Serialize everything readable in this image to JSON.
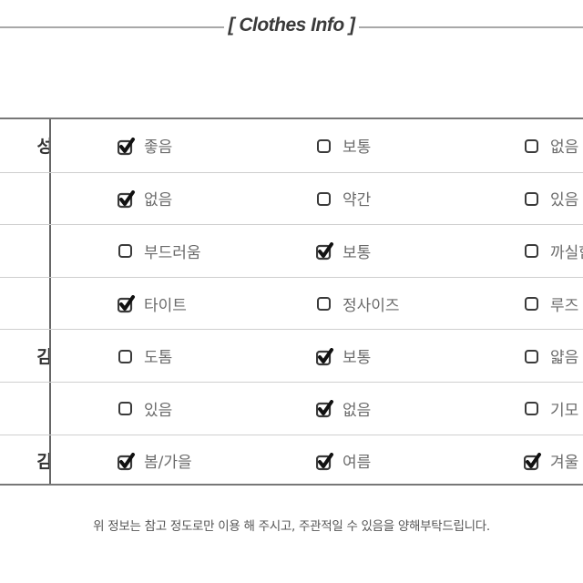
{
  "header": {
    "title": "[ Clothes Info ]"
  },
  "table": {
    "rows": [
      {
        "label": "성",
        "options": [
          {
            "label": "좋음",
            "checked": true
          },
          {
            "label": "보통",
            "checked": false
          },
          {
            "label": "없음",
            "checked": false
          }
        ]
      },
      {
        "label": "",
        "options": [
          {
            "label": "없음",
            "checked": true
          },
          {
            "label": "약간",
            "checked": false
          },
          {
            "label": "있음",
            "checked": false
          }
        ]
      },
      {
        "label": "",
        "options": [
          {
            "label": "부드러움",
            "checked": false
          },
          {
            "label": "보통",
            "checked": true
          },
          {
            "label": "까실함",
            "checked": false
          }
        ]
      },
      {
        "label": "",
        "options": [
          {
            "label": "타이트",
            "checked": true
          },
          {
            "label": "정사이즈",
            "checked": false
          },
          {
            "label": "루즈",
            "checked": false
          }
        ]
      },
      {
        "label": "감",
        "options": [
          {
            "label": "도톰",
            "checked": false
          },
          {
            "label": "보통",
            "checked": true
          },
          {
            "label": "얇음",
            "checked": false
          }
        ]
      },
      {
        "label": "",
        "options": [
          {
            "label": "있음",
            "checked": false
          },
          {
            "label": "없음",
            "checked": true
          },
          {
            "label": "기모",
            "checked": false
          }
        ]
      },
      {
        "label": "감",
        "options": [
          {
            "label": "봄/가을",
            "checked": true
          },
          {
            "label": "여름",
            "checked": true
          },
          {
            "label": "겨울",
            "checked": true
          }
        ]
      }
    ]
  },
  "footnote": "위 정보는 참고 정도로만 이용 해 주시고, 주관적일 수 있음을 양해부탁드립니다.",
  "colors": {
    "border": "#777777",
    "row_separator": "#cfcfcf",
    "text": "#6a6a6a",
    "checkbox": "#3a3a3a"
  }
}
